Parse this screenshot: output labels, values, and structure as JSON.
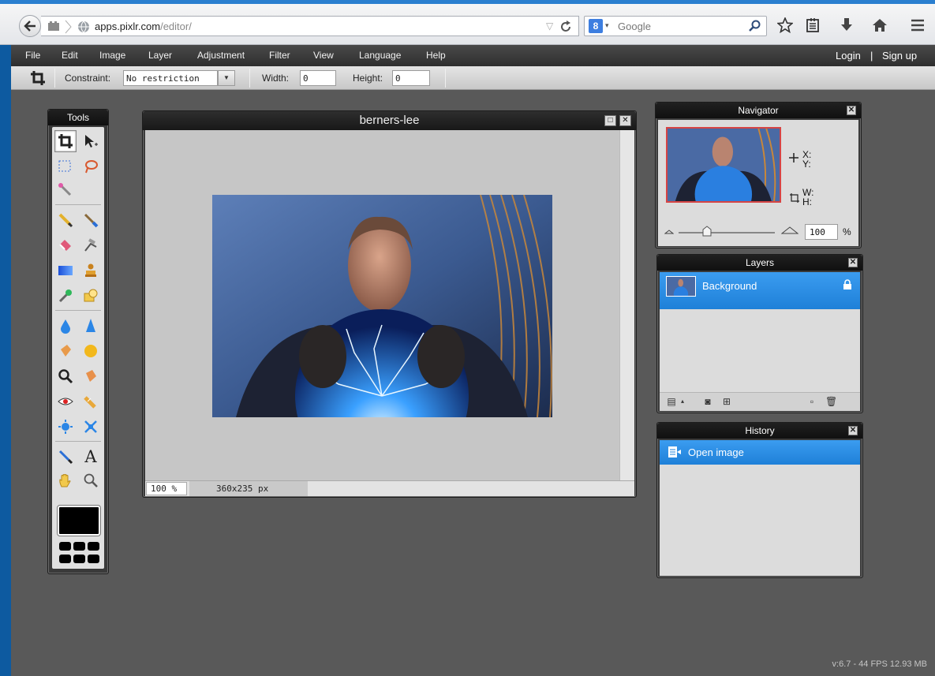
{
  "browser": {
    "url_host": "apps.pixlr.com",
    "url_path": "/editor/",
    "search_engine": "Google"
  },
  "menu": {
    "items": [
      "File",
      "Edit",
      "Image",
      "Layer",
      "Adjustment",
      "Filter",
      "View",
      "Language",
      "Help"
    ],
    "login": "Login",
    "separator": "|",
    "signup": "Sign up"
  },
  "options": {
    "constraint_label": "Constraint:",
    "constraint_value": "No restriction",
    "width_label": "Width:",
    "width_value": "0",
    "height_label": "Height:",
    "height_value": "0"
  },
  "tools": {
    "title": "Tools"
  },
  "document": {
    "title": "berners-lee",
    "zoom": "100 %",
    "size": "360x235 px"
  },
  "navigator": {
    "title": "Navigator",
    "x_label": "X:",
    "y_label": "Y:",
    "w_label": "W:",
    "h_label": "H:",
    "zoom": "100",
    "zoom_unit": "%"
  },
  "layers": {
    "title": "Layers",
    "items": [
      {
        "name": "Background"
      }
    ]
  },
  "history": {
    "title": "History",
    "items": [
      {
        "name": "Open image"
      }
    ]
  },
  "status": {
    "version": "v:6.7 - 44 FPS 12.93 MB"
  },
  "colors": {
    "accent": "#2b8be6",
    "menubar": "#3a3a3a",
    "workspace": "#595959"
  }
}
